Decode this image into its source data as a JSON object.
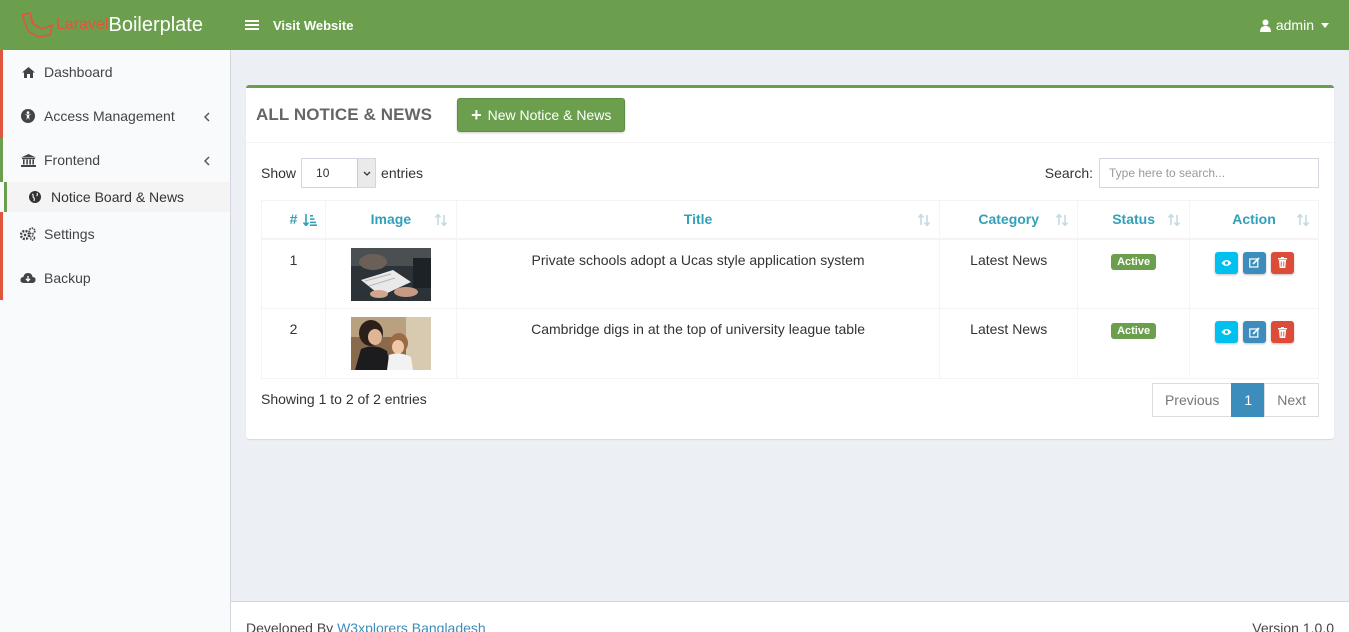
{
  "header": {
    "brand_part1": "Laravel",
    "brand_part2": "Boilerplate",
    "visit_label": "Visit Website",
    "user_label": "admin"
  },
  "sidebar": {
    "items": [
      {
        "label": "Dashboard",
        "icon": "home-icon"
      },
      {
        "label": "Access Management",
        "icon": "universal-access-icon"
      },
      {
        "label": "Frontend",
        "icon": "bank-icon"
      },
      {
        "label": "Notice Board & News",
        "icon": "globe-icon"
      },
      {
        "label": "Settings",
        "icon": "gears-icon"
      },
      {
        "label": "Backup",
        "icon": "cloud-download-icon"
      }
    ]
  },
  "box": {
    "title": "ALL NOTICE & NEWS",
    "new_button": "New Notice & News"
  },
  "controls": {
    "show_label": "Show",
    "entries_value": "10",
    "entries_label": "entries",
    "search_label": "Search:",
    "search_placeholder": "Type here to search..."
  },
  "table": {
    "columns": [
      "#",
      "Image",
      "Title",
      "Category",
      "Status",
      "Action"
    ],
    "rows": [
      {
        "num": "1",
        "title": "Private schools adopt a Ucas style application system",
        "category": "Latest News",
        "status": "Active"
      },
      {
        "num": "2",
        "title": "Cambridge digs in at the top of university league table",
        "category": "Latest News",
        "status": "Active"
      }
    ]
  },
  "pagination": {
    "info": "Showing 1 to 2 of 2 entries",
    "previous": "Previous",
    "page": "1",
    "next": "Next"
  },
  "footer": {
    "developed_by": "Developed By",
    "company": "W3xplorers Bangladesh",
    "version": "Version 1.0.0"
  },
  "colors": {
    "header_green": "#6b9f4d",
    "accent_red": "#e2553d",
    "table_header_teal": "#31a0b8",
    "view_button": "#00c0ef",
    "edit_button": "#3c8dbc",
    "delete_button": "#dd4b39"
  }
}
